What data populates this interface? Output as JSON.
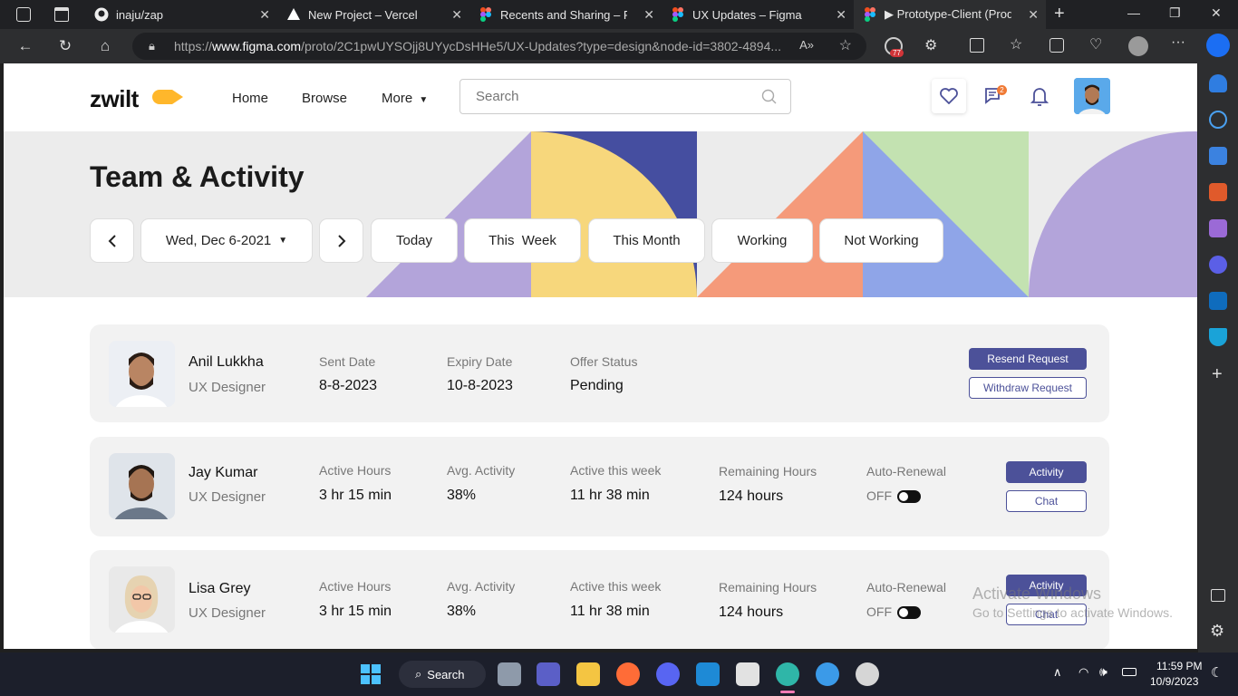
{
  "browser": {
    "tabs": [
      {
        "title": "inaju/zap",
        "icon": "github-icon"
      },
      {
        "title": "New Project – Vercel",
        "icon": "vercel-icon"
      },
      {
        "title": "Recents and Sharing – Figma",
        "icon": "figma-icon"
      },
      {
        "title": "UX Updates – Figma",
        "icon": "figma-icon"
      },
      {
        "title": "▶ Prototype-Client (Product",
        "icon": "figma-icon"
      }
    ],
    "url_prefix": "https://",
    "url_host": "www.figma.com",
    "url_rest": "/proto/2C1pwUYSOjj8UYycDsHHe5/UX-Updates?type=design&node-id=3802-4894...",
    "extension_badge": "77"
  },
  "header": {
    "logo": "zwilt",
    "nav": [
      "Home",
      "Browse",
      "More"
    ],
    "search_placeholder": "Search",
    "messages_badge": "2"
  },
  "hero": {
    "title": "Team & Activity",
    "date_label": "Wed, Dec 6-2021",
    "filters": [
      "Today",
      "This  Week",
      "This Month",
      "Working",
      "Not Working"
    ]
  },
  "offer": {
    "name": "Anil Lukkha",
    "role": "UX Designer",
    "sent_label": "Sent Date",
    "sent_value": "8-8-2023",
    "expiry_label": "Expiry Date",
    "expiry_value": "10-8-2023",
    "status_label": "Offer Status",
    "status_value": "Pending",
    "primary_btn": "Resend Request",
    "secondary_btn": "Withdraw Request"
  },
  "members": [
    {
      "name": "Jay Kumar",
      "role": "UX Designer",
      "active_hours_label": "Active Hours",
      "active_hours": "3 hr 15 min",
      "avg_label": "Avg. Activity",
      "avg": "38%",
      "week_label": "Active this week",
      "week": "11 hr 38 min",
      "remaining_label": "Remaining Hours",
      "remaining": "124 hours",
      "renewal_label": "Auto-Renewal",
      "renewal": "OFF",
      "primary_btn": "Activity",
      "secondary_btn": "Chat"
    },
    {
      "name": "Lisa Grey",
      "role": "UX Designer",
      "active_hours_label": "Active Hours",
      "active_hours": "3 hr 15 min",
      "avg_label": "Avg. Activity",
      "avg": "38%",
      "week_label": "Active this week",
      "week": "11 hr 38 min",
      "remaining_label": "Remaining Hours",
      "remaining": "124 hours",
      "renewal_label": "Auto-Renewal",
      "renewal": "OFF",
      "primary_btn": "Activity",
      "secondary_btn": "Chat"
    }
  ],
  "watermark": {
    "line1": "Activate Windows",
    "line2": "Go to Settings to activate Windows."
  },
  "taskbar": {
    "search_label": "Search",
    "time": "11:59 PM",
    "date": "10/9/2023"
  },
  "colors": {
    "accent": "#4c5199",
    "hero_purple": "#b3a4da",
    "hero_yellow": "#f7d77c",
    "hero_navy": "#454ea0",
    "hero_orange": "#f59a7a",
    "hero_blue": "#8fa5e8",
    "hero_green": "#c3e2b1"
  }
}
